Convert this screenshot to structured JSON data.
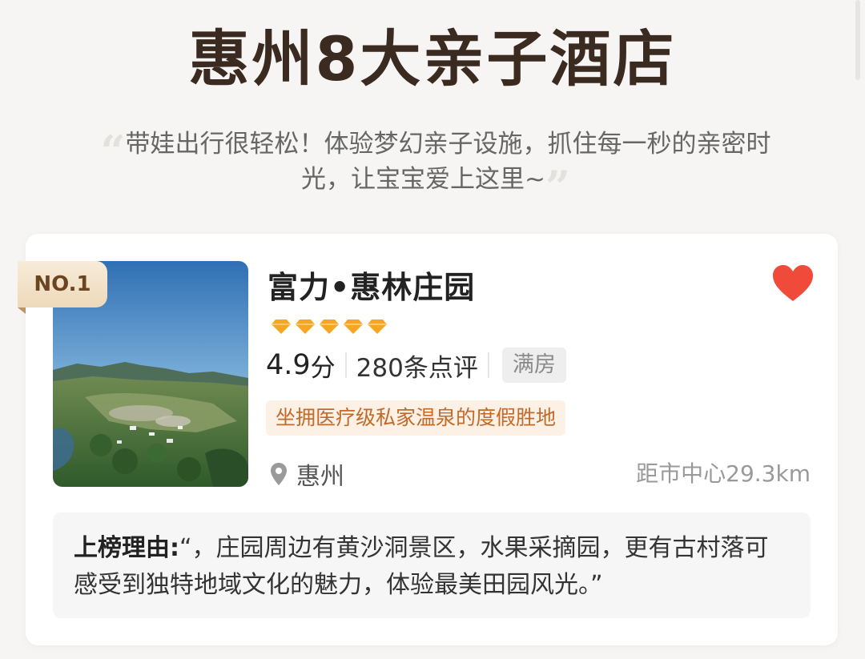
{
  "header": {
    "title": "惠州8大亲子酒店",
    "subtitle": "带娃出行很轻松！体验梦幻亲子设施，抓住每一秒的亲密时光，让宝宝爱上这里~"
  },
  "card": {
    "rank": "NO.1",
    "hotel_name": "富力•惠林庄园",
    "diamond_count": 5,
    "score": "4.9",
    "score_unit": "分",
    "reviews": "280条点评",
    "status_tag": "满房",
    "feature_tag": "坐拥医疗级私家温泉的度假胜地",
    "location": "惠州",
    "distance": "距市中心29.3km",
    "favorited": true,
    "reason_label": "上榜理由:",
    "reason_text": "“，庄园周边有黄沙洞景区，水果采摘园，更有古村落可感受到独特地域文化的魅力，体验最美田园风光。”"
  },
  "colors": {
    "title": "#3a2a20",
    "diamond": "#f5a623",
    "heart": "#f04b3a",
    "feature_text": "#c26a2a",
    "feature_bg": "#fdf0e4",
    "badge_bg": "#f2e2c8"
  },
  "icons": {
    "favorite": "heart-icon",
    "rating": "diamond-icon",
    "location": "location-pin-icon"
  }
}
